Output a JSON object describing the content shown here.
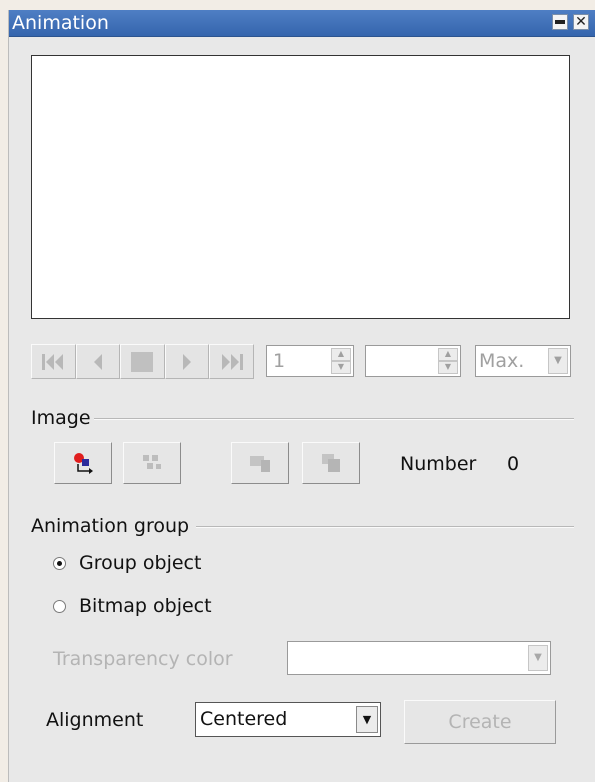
{
  "window": {
    "title": "Animation"
  },
  "playback": {
    "frame_value": "1",
    "duration_value": "",
    "loop_value": "Max."
  },
  "image_section": {
    "label": "Image",
    "number_label": "Number",
    "number_value": "0"
  },
  "animation_group": {
    "label": "Animation group",
    "options": [
      {
        "label": "Group object",
        "selected": true
      },
      {
        "label": "Bitmap object",
        "selected": false
      }
    ],
    "transparency_label": "Transparency color",
    "transparency_value": "",
    "alignment_label": "Alignment",
    "alignment_value": "Centered",
    "create_label": "Create"
  },
  "colors": {
    "titlebar": "#3a6bb4",
    "dialog_bg": "#e8e8e8",
    "disabled_text": "#b4b4b4"
  },
  "icons": [
    "first-frame-icon",
    "previous-frame-icon",
    "stop-icon",
    "play-icon",
    "last-frame-icon",
    "apply-object-icon",
    "apply-objects-individually-icon",
    "delete-current-image-icon",
    "delete-all-images-icon"
  ]
}
